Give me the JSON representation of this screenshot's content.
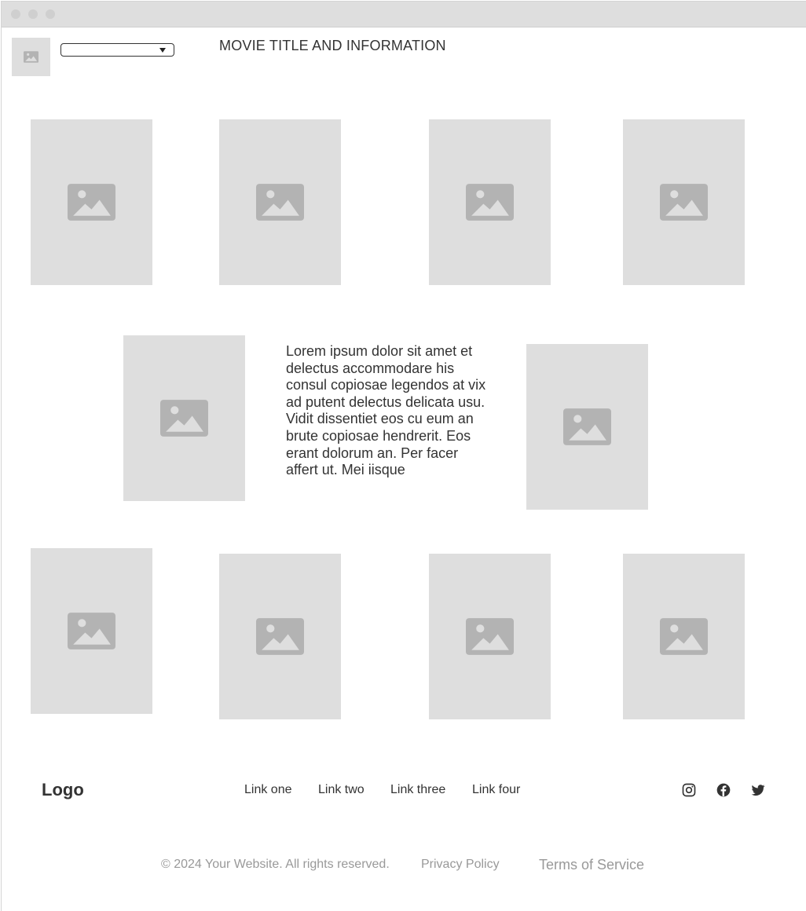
{
  "window": {
    "traffic_lights": [
      "close",
      "minimize",
      "maximize"
    ]
  },
  "header": {
    "logo_image_icon": "image-placeholder-icon",
    "dropdown": {
      "selected": "",
      "icon": "caret-down-icon"
    },
    "title": "MOVIE TITLE AND INFORMATION"
  },
  "gallery_top": [
    {
      "icon": "image-placeholder-icon"
    },
    {
      "icon": "image-placeholder-icon"
    },
    {
      "icon": "image-placeholder-icon"
    },
    {
      "icon": "image-placeholder-icon"
    }
  ],
  "feature": {
    "description": "Lorem ipsum dolor sit amet et delectus accommodare his consul copiosae legendos at vix ad putent delectus delicata usu. Vidit dissentiet eos cu eum an brute copiosae hendrerit. Eos erant dolorum an. Per facer affert ut. Mei iisque"
  },
  "footer": {
    "logo": "Logo",
    "links": [
      "Link one",
      "Link two",
      "Link three",
      "Link four"
    ],
    "social": [
      "instagram-icon",
      "facebook-icon",
      "twitter-icon"
    ],
    "copyright": "© 2024 Your Website. All rights reserved.",
    "privacy": "Privacy Policy",
    "terms": "Terms of Service"
  },
  "colors": {
    "placeholder_bg": "#dedede",
    "placeholder_icon": "#b3b3b3",
    "text": "#333333",
    "muted_text": "#999999"
  }
}
